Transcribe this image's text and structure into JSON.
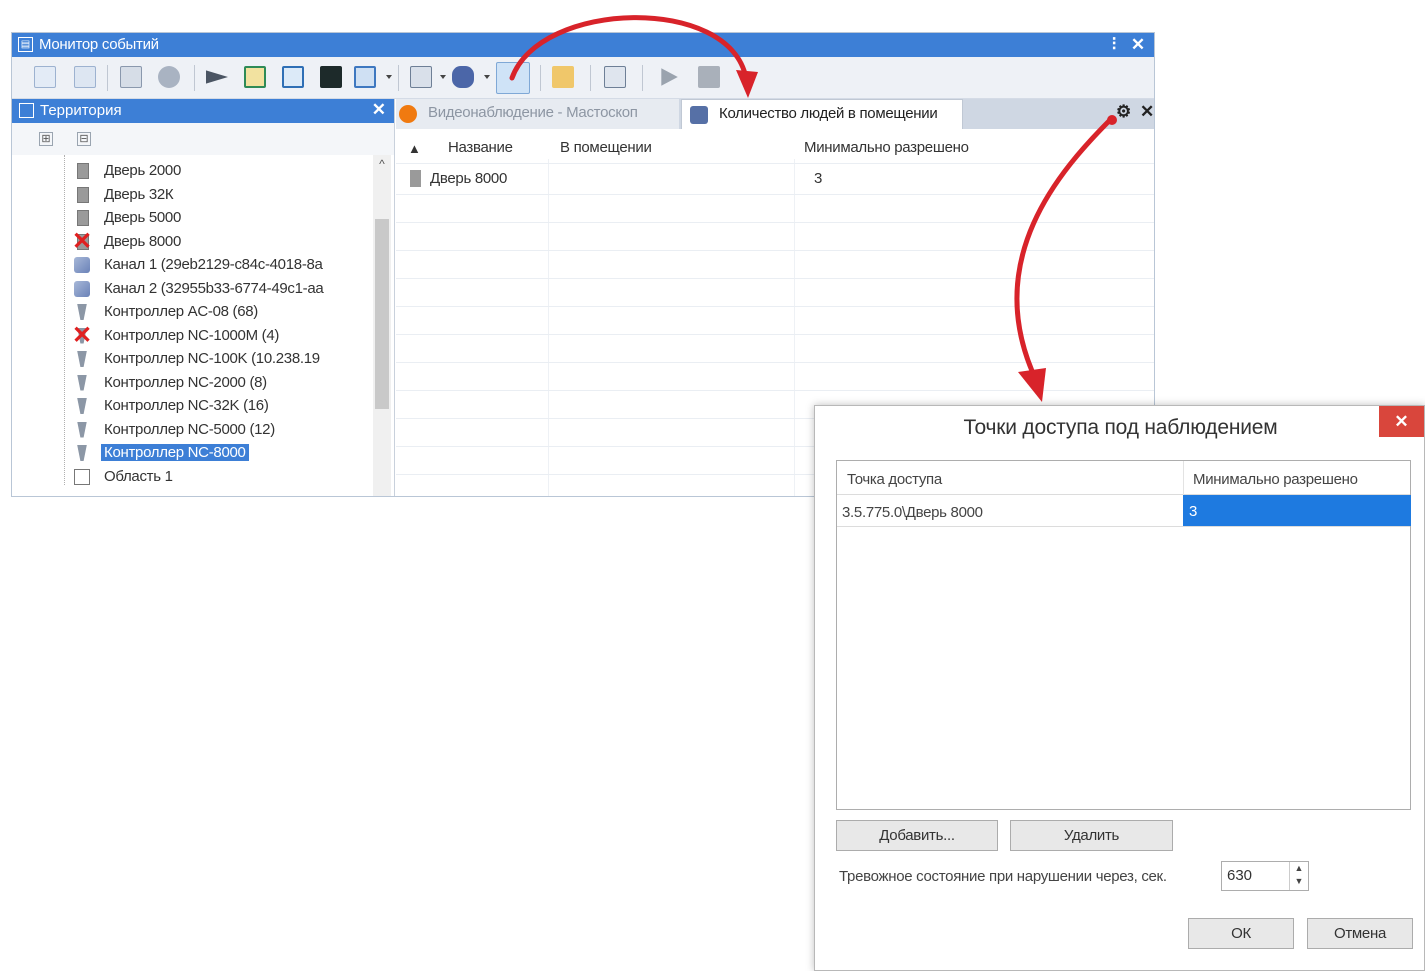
{
  "main_window": {
    "title": "Монитор событий",
    "pin_glyph": "⫶",
    "close_glyph": "✕"
  },
  "left_panel": {
    "title": "Территория",
    "close_glyph": "✕",
    "expand_glyph": "⊞",
    "collapse_glyph": "⊟",
    "tree": [
      {
        "label": "Дверь 2000",
        "icon": "door-icon",
        "error": false,
        "selected": false
      },
      {
        "label": "Дверь 32К",
        "icon": "door-icon",
        "error": false,
        "selected": false
      },
      {
        "label": "Дверь 5000",
        "icon": "door-icon",
        "error": false,
        "selected": false
      },
      {
        "label": "Дверь 8000",
        "icon": "door-icon",
        "error": true,
        "selected": false
      },
      {
        "label": "Канал 1 (29eb2129-c84c-4018-8a",
        "icon": "channel-icon",
        "error": false,
        "selected": false
      },
      {
        "label": "Канал 2 (32955b33-6774-49c1-aa",
        "icon": "channel-icon",
        "error": false,
        "selected": false
      },
      {
        "label": "Контроллер AC-08 (68)",
        "icon": "controller-icon",
        "error": false,
        "selected": false
      },
      {
        "label": "Контроллер NC-1000M (4)",
        "icon": "controller-icon",
        "error": true,
        "selected": false
      },
      {
        "label": "Контроллер NC-100K (10.238.19",
        "icon": "controller-icon",
        "error": false,
        "selected": false
      },
      {
        "label": "Контроллер NC-2000 (8)",
        "icon": "controller-icon",
        "error": false,
        "selected": false
      },
      {
        "label": "Контроллер NC-32K (16)",
        "icon": "controller-icon",
        "error": false,
        "selected": false
      },
      {
        "label": "Контроллер NC-5000 (12)",
        "icon": "controller-icon",
        "error": false,
        "selected": false
      },
      {
        "label": "Контроллер NC-8000",
        "icon": "controller-icon",
        "error": false,
        "selected": true
      },
      {
        "label": "Область 1",
        "icon": "area-icon",
        "error": false,
        "selected": false
      }
    ]
  },
  "tabs": [
    {
      "label": "Видеонаблюдение - Мастоскоп",
      "icon": "video-icon",
      "active": false
    },
    {
      "label": "Количество людей в помещении",
      "icon": "people-count-icon",
      "active": true
    }
  ],
  "grid": {
    "sort_glyph": "▲",
    "columns": [
      "Название",
      "В помещении",
      "Минимально разрешено"
    ],
    "rows": [
      {
        "name": "Дверь 8000",
        "in_room": "",
        "min_allowed": "3"
      }
    ],
    "settings_glyph": "⚙",
    "close_glyph": "✕"
  },
  "dialog": {
    "title": "Точки доступа под наблюдением",
    "close_glyph": "✕",
    "columns": [
      "Точка доступа",
      "Минимально разрешено"
    ],
    "rows": [
      {
        "access_point": "3.5.775.0\\Дверь 8000",
        "min_allowed": "3"
      }
    ],
    "add_button": "Добавить...",
    "remove_button": "Удалить",
    "alarm_label": "Тревожное состояние при нарушении через, сек.",
    "alarm_value": "630",
    "ok_button": "ОК",
    "cancel_button": "Отмена"
  },
  "colors": {
    "title_blue": "#3d7fd6",
    "selection_blue": "#1e7ae0",
    "arrow_red": "#d8232a",
    "close_red": "#d9463c"
  }
}
